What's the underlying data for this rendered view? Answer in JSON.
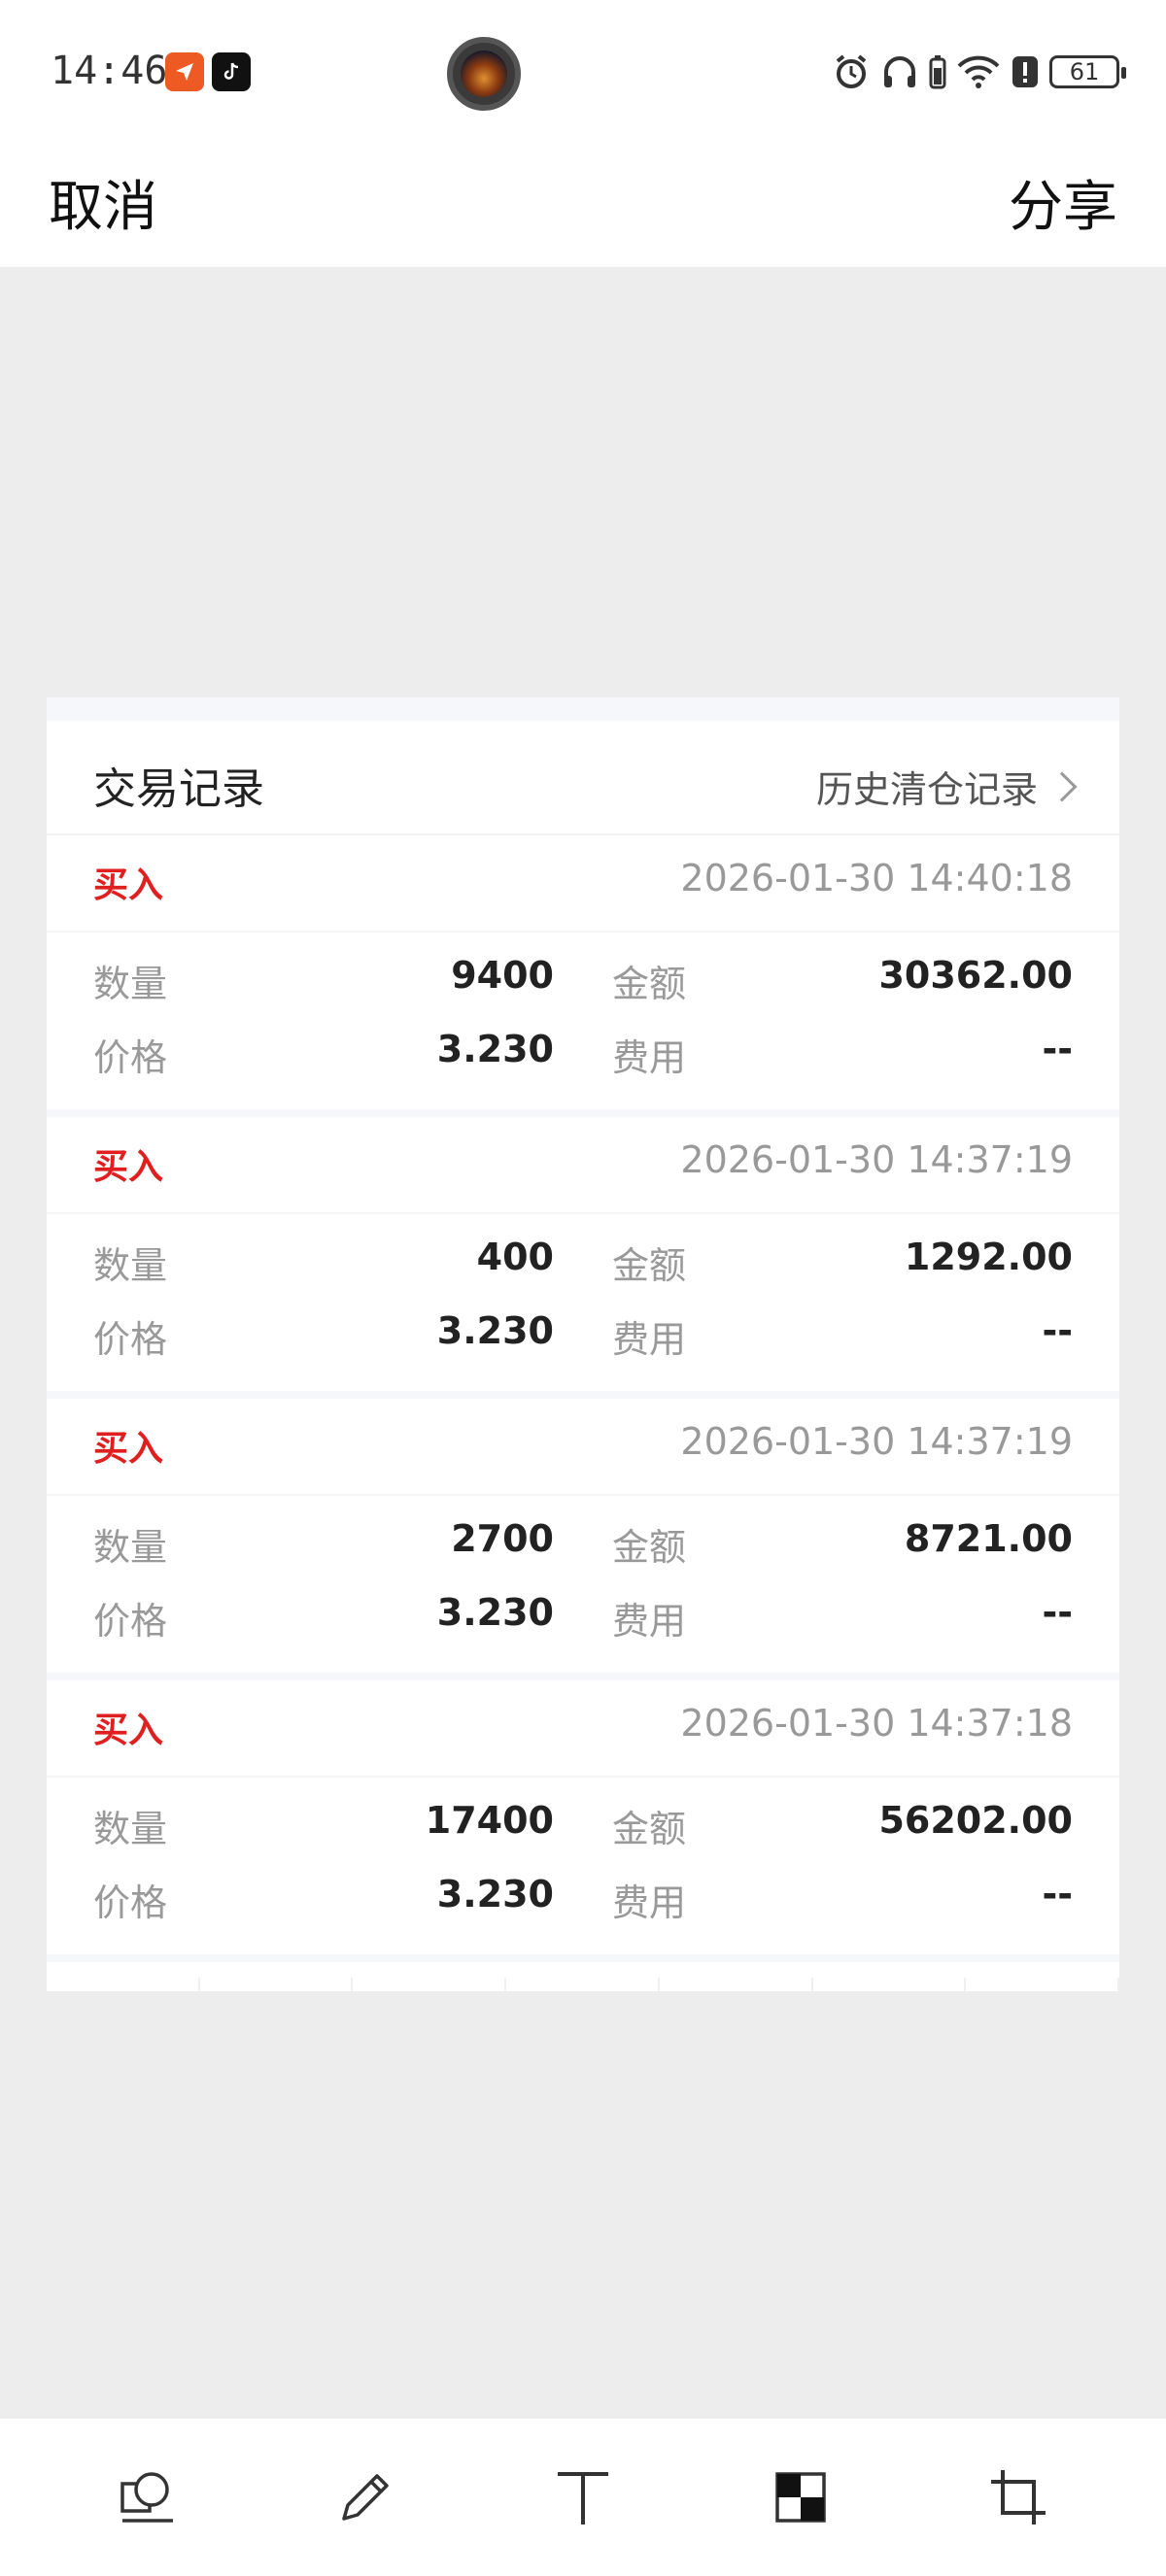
{
  "status_bar": {
    "time": "14:46",
    "battery": "61"
  },
  "top_bar": {
    "cancel_label": "取消",
    "share_label": "分享"
  },
  "card": {
    "title": "交易记录",
    "history_link": "历史清仓记录",
    "labels": {
      "quantity": "数量",
      "amount": "金额",
      "price": "价格",
      "fee": "费用"
    },
    "records": [
      {
        "type": "买入",
        "time": "2026-01-30 14:40:18",
        "quantity": "9400",
        "amount": "30362.00",
        "price": "3.230",
        "fee": "--"
      },
      {
        "type": "买入",
        "time": "2026-01-30 14:37:19",
        "quantity": "400",
        "amount": "1292.00",
        "price": "3.230",
        "fee": "--"
      },
      {
        "type": "买入",
        "time": "2026-01-30 14:37:19",
        "quantity": "2700",
        "amount": "8721.00",
        "price": "3.230",
        "fee": "--"
      },
      {
        "type": "买入",
        "time": "2026-01-30 14:37:18",
        "quantity": "17400",
        "amount": "56202.00",
        "price": "3.230",
        "fee": "--"
      }
    ]
  },
  "colors": {
    "buy": "#e02020",
    "background": "#ededed"
  },
  "toolbar": {
    "icons": [
      "shape-icon",
      "pencil-icon",
      "text-icon",
      "mosaic-icon",
      "crop-icon"
    ]
  }
}
